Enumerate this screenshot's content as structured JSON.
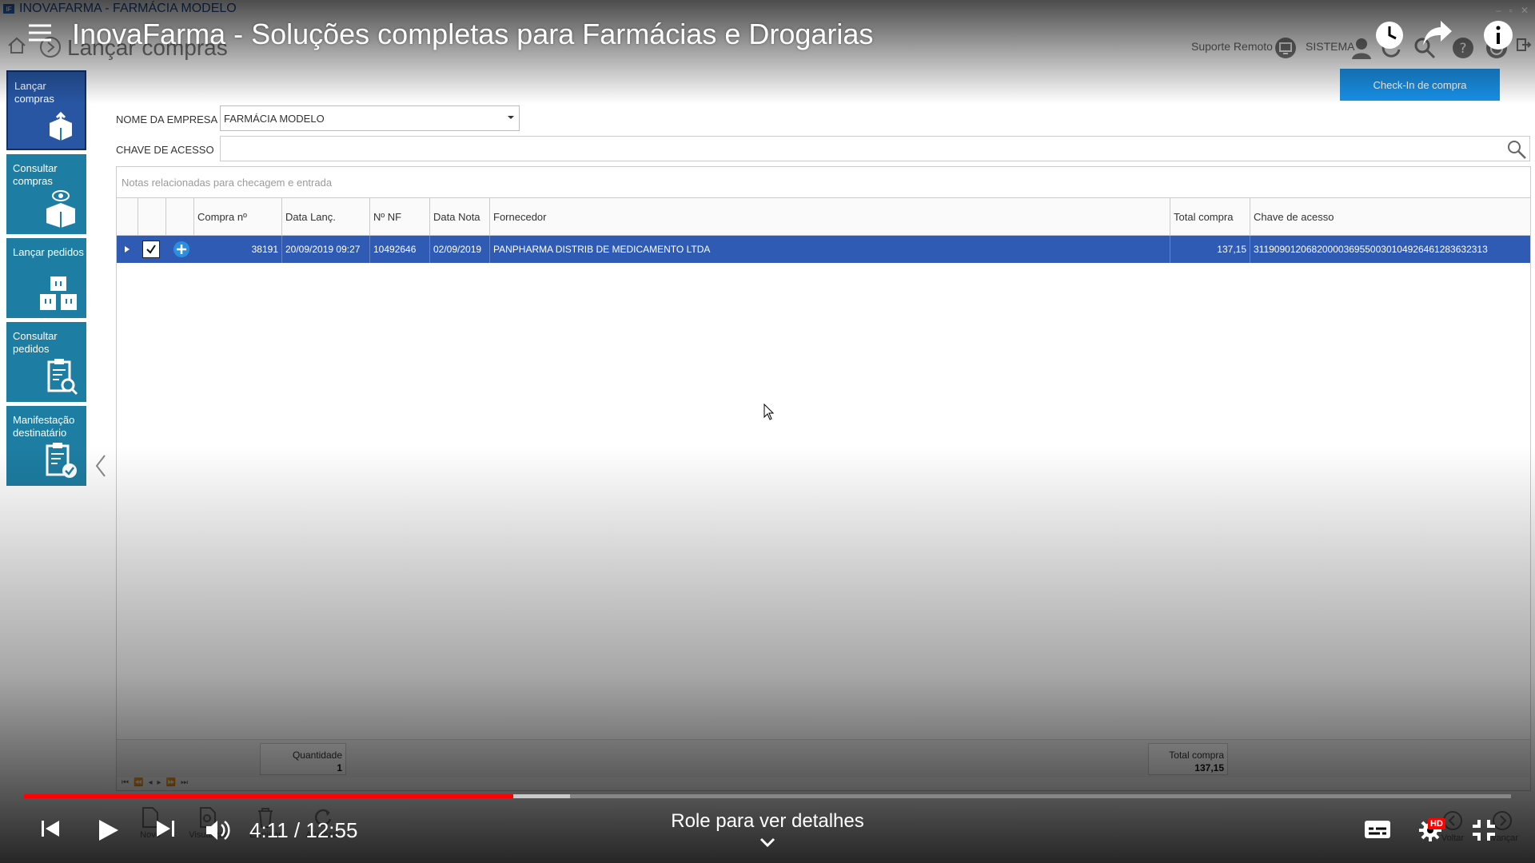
{
  "window": {
    "title": "INOVAFARMA - FARMÁCIA MODELO",
    "logo_text": "IF"
  },
  "header": {
    "page_title": "Lançar compras",
    "suporte_label": "Suporte Remoto",
    "sistema_label": "SISTEMA"
  },
  "video": {
    "title": "InovaFarma - Soluções completas para Farmácias e Drogarias",
    "current_time": "4:11",
    "duration": "12:55",
    "progress_fraction": 0.329,
    "buffered_fraction": 0.367,
    "scroll_hint": "Role para ver detalhes",
    "quality_badge": "HD",
    "accent_color": "#ff0000"
  },
  "sidebar": {
    "items": [
      {
        "label": "Lançar compras",
        "icon": "box-upload-icon"
      },
      {
        "label": "Consultar compras",
        "icon": "box-eye-icon"
      },
      {
        "label": "Lançar pedidos",
        "icon": "boxes-icon"
      },
      {
        "label": "Consultar pedidos",
        "icon": "clipboard-search-icon"
      },
      {
        "label": "Manifestação destinatário",
        "icon": "clipboard-check-icon"
      }
    ]
  },
  "form": {
    "empresa_label": "NOME DA EMPRESA",
    "empresa_value": "FARMÁCIA MODELO",
    "chave_label": "CHAVE DE ACESSO",
    "chave_value": "",
    "checkin_button": "Check-In de compra"
  },
  "grid": {
    "caption": "Notas relacionadas para checagem e entrada",
    "columns": [
      "Compra nº",
      "Data Lanç.",
      "Nº NF",
      "Data Nota",
      "Fornecedor",
      "Total compra",
      "Chave de acesso"
    ],
    "rows": [
      {
        "compra": "38191",
        "data_lanc": "20/09/2019 09:27",
        "nf": "10492646",
        "data_nota": "02/09/2019",
        "fornecedor": "PANPHARMA DISTRIB DE MEDICAMENTO LTDA",
        "total": "137,15",
        "chave": "31190901206820000369550030104926461283632313"
      }
    ],
    "footer": {
      "quantidade_label": "Quantidade",
      "quantidade_value": "1",
      "total_label": "Total compra",
      "total_value": "137,15"
    },
    "selected_row_color": "#2f5bb5"
  },
  "toolbar": {
    "novo": "Novo",
    "visualizar": "Visualizar",
    "eliminar": "Eliminar",
    "atualizar": "Atualizar",
    "voltar": "Voltar",
    "avancar": "Avançar"
  },
  "colors": {
    "sidebar_tile": "#1d7da2",
    "sidebar_active": "#2856a3",
    "checkin_button": "#1990e6"
  }
}
